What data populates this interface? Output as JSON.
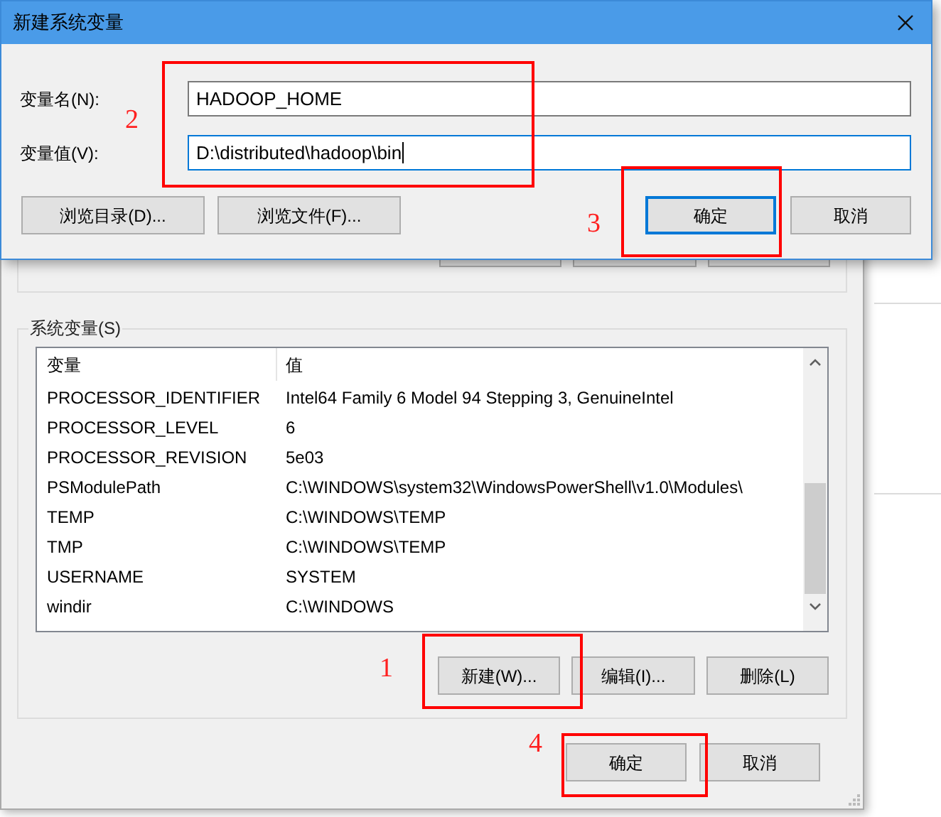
{
  "environment_dialog": {
    "system_variables": {
      "title": "系统变量(S)",
      "columns": [
        "变量",
        "值"
      ],
      "rows": [
        {
          "name": "PROCESSOR_IDENTIFIER",
          "value": "Intel64 Family 6 Model 94 Stepping 3, GenuineIntel"
        },
        {
          "name": "PROCESSOR_LEVEL",
          "value": "6"
        },
        {
          "name": "PROCESSOR_REVISION",
          "value": "5e03"
        },
        {
          "name": "PSModulePath",
          "value": "C:\\WINDOWS\\system32\\WindowsPowerShell\\v1.0\\Modules\\"
        },
        {
          "name": "TEMP",
          "value": "C:\\WINDOWS\\TEMP"
        },
        {
          "name": "TMP",
          "value": "C:\\WINDOWS\\TEMP"
        },
        {
          "name": "USERNAME",
          "value": "SYSTEM"
        },
        {
          "name": "windir",
          "value": "C:\\WINDOWS"
        }
      ],
      "buttons": [
        "新建(W)...",
        "编辑(I)...",
        "删除(L)"
      ]
    },
    "buttons": [
      "确定",
      "取消"
    ]
  },
  "new_variable_dialog": {
    "title": "新建系统变量",
    "fields": [
      {
        "label": "变量名(N):",
        "value": "HADOOP_HOME",
        "focused": false
      },
      {
        "label": "变量值(V):",
        "value": "D:\\distributed\\hadoop\\bin",
        "focused": true
      }
    ],
    "browse_buttons": [
      "浏览目录(D)...",
      "浏览文件(F)..."
    ],
    "buttons": [
      {
        "label": "确定",
        "default": true
      },
      {
        "label": "取消",
        "default": false
      }
    ]
  },
  "annotations": [
    {
      "number": "2"
    },
    {
      "number": "3"
    },
    {
      "number": "1"
    },
    {
      "number": "4"
    }
  ]
}
